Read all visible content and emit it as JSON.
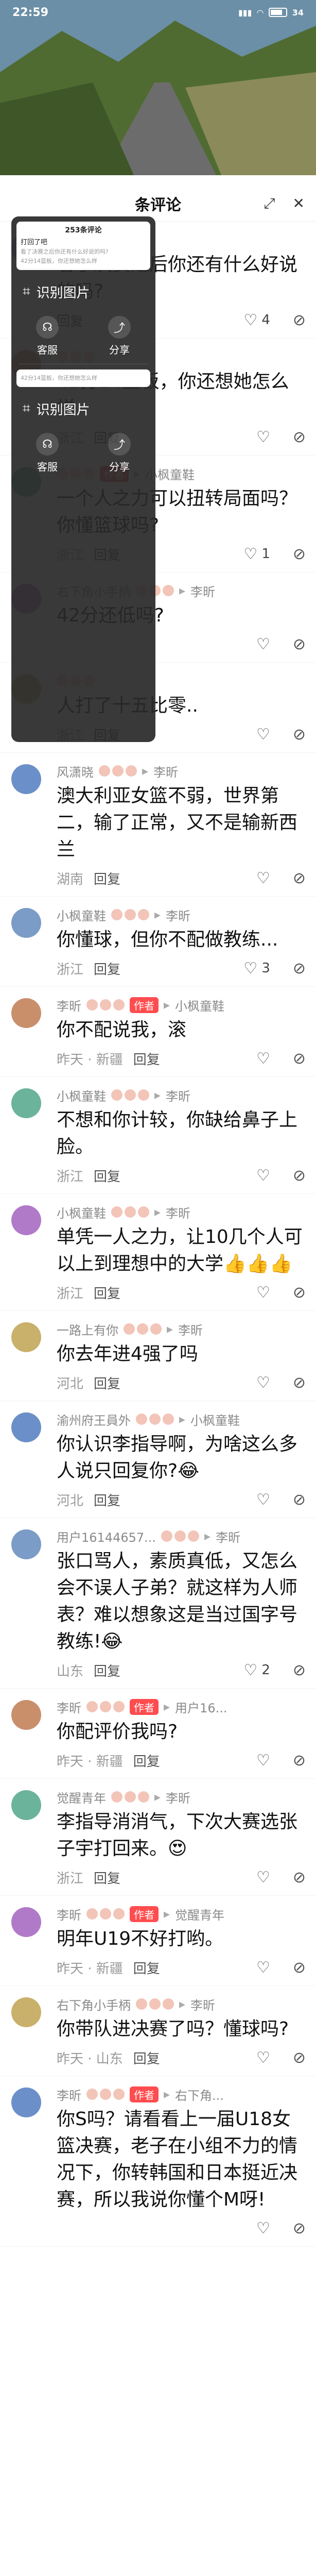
{
  "status_bar": {
    "time": "22:59",
    "battery": "34"
  },
  "panel": {
    "title": "条评论"
  },
  "mini_window": {
    "card_header": "253条评论",
    "lines": [
      "打回了吧",
      "看了决赛之后你还有什么好说的吗?",
      "42分14篮板，你还想她怎么样"
    ],
    "recognize_label": "识别图片",
    "service_label": "客服",
    "share_label": "分享",
    "author_tag_note": "作者"
  },
  "comments": [
    {
      "user": "",
      "tag": "",
      "text": "看了决赛之后你还有什么好说的吗?",
      "location": "",
      "reply": "回复",
      "likes": "4"
    },
    {
      "user": "",
      "tag": "",
      "text": "42分14篮板，你还想她怎么样",
      "location": "浙江",
      "reply": "回复",
      "likes": ""
    },
    {
      "user": "",
      "tag": "作者",
      "mention": "小枫童鞋",
      "text": "一个人之力可以扭转局面吗？你懂篮球吗?",
      "location": "浙江",
      "reply": "回复",
      "likes": "1"
    },
    {
      "user": "右下角小手柄",
      "tag": "",
      "mention": "李昕",
      "text": "42分还低吗?",
      "location": "",
      "reply": "",
      "likes": ""
    },
    {
      "user": "",
      "tag": "",
      "text": "人打了十五比零..",
      "location": "浙江",
      "reply": "回复",
      "likes": ""
    },
    {
      "user": "风潇晓",
      "tag": "",
      "mention": "李昕",
      "text": "澳大利亚女篮不弱，世界第二，输了正常，又不是输新西兰",
      "location": "湖南",
      "reply": "回复",
      "likes": ""
    },
    {
      "user": "小枫童鞋",
      "tag": "",
      "mention": "李昕",
      "text": "你懂球，但你不配做教练...",
      "location": "浙江",
      "reply": "回复",
      "likes": "3"
    },
    {
      "user": "李昕",
      "tag": "作者",
      "mention": "小枫童鞋",
      "text": "你不配说我，滚",
      "location": "昨天 · 新疆",
      "reply": "回复",
      "likes": ""
    },
    {
      "user": "小枫童鞋",
      "tag": "",
      "mention": "李昕",
      "text": "不想和你计较，你缺给鼻子上脸。",
      "location": "浙江",
      "reply": "回复",
      "likes": ""
    },
    {
      "user": "小枫童鞋",
      "tag": "",
      "mention": "李昕",
      "text": "单凭一人之力，让10几个人可以上到理想中的大学👍👍👍",
      "location": "浙江",
      "reply": "回复",
      "likes": ""
    },
    {
      "user": "一路上有你",
      "tag": "",
      "mention": "李昕",
      "text": "你去年进4强了吗",
      "location": "河北",
      "reply": "回复",
      "likes": ""
    },
    {
      "user": "渝州府王員外",
      "tag": "",
      "mention": "小枫童鞋",
      "text": "你认识李指导啊，为啥这么多人说只回复你?😂",
      "location": "河北",
      "reply": "回复",
      "likes": ""
    },
    {
      "user": "用户16144657...",
      "tag": "",
      "mention": "李昕",
      "text": "张口骂人，素质真低，又怎么会不误人子弟？就这样为人师表？难以想象这是当过国字号教练!😂",
      "location": "山东",
      "reply": "回复",
      "likes": "2"
    },
    {
      "user": "李昕",
      "tag": "作者",
      "mention": "用户16...",
      "text": "你配评价我吗?",
      "location": "昨天 · 新疆",
      "reply": "回复",
      "likes": ""
    },
    {
      "user": "觉醒青年",
      "tag": "",
      "mention": "李昕",
      "text": "李指导消消气，下次大赛选张子宇打回来。😍",
      "location": "浙江",
      "reply": "回复",
      "likes": ""
    },
    {
      "user": "李昕",
      "tag": "作者",
      "mention": "觉醒青年",
      "text": "明年U19不好打哟。",
      "location": "昨天 · 新疆",
      "reply": "回复",
      "likes": ""
    },
    {
      "user": "右下角小手柄",
      "tag": "",
      "mention": "李昕",
      "text": "你带队进决赛了吗？懂球吗?",
      "location": "昨天 · 山东",
      "reply": "回复",
      "likes": ""
    },
    {
      "user": "李昕",
      "tag": "作者",
      "mention": "右下角...",
      "text": "你S吗？请看看上一届U18女篮决赛，老子在小组不力的情况下，你转韩国和日本挺近决赛，所以我说你懂个M呀!",
      "location": "",
      "reply": "",
      "likes": ""
    }
  ]
}
